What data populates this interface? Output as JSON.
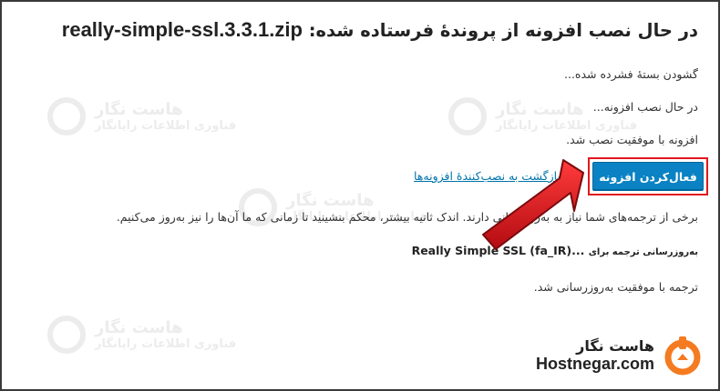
{
  "title": {
    "prefix": "در حال نصب افزونه از پروندهٔ فرستاده شده:",
    "filename": "really-simple-ssl.3.3.1.zip"
  },
  "messages": {
    "unpacking": "گشودن بستهٔ فشرده شده...",
    "installing": "در حال نصب افزونه...",
    "success": "افزونه با موفقیت نصب شد."
  },
  "actions": {
    "activate_label": "فعال‌کردن افزونه",
    "back_link": "بازگشت به نصب‌کنندهٔ افزونه‌ها"
  },
  "translations": {
    "notice": "برخی از ترجمه‌های شما نیاز به به‌روزرسانی دارند. اندک ثانیه بیشتر، محکم بنشینید تا زمانی که ما آن‌ها را نیز به‌روز می‌کنیم.",
    "updating_prefix": "به‌روزرسانی ترجمه برای",
    "updating_target": "Really Simple SSL (fa_IR)...",
    "done": "ترجمه با موفقیت به‌روزرسانی شد."
  },
  "watermark": {
    "name": "هاست نگار",
    "tagline": "فناوری اطلاعات رایانگار"
  },
  "brand": {
    "name_fa": "هاست نگار",
    "name_en": "Hostnegar.com",
    "color": "#f47b20"
  },
  "colors": {
    "button": "#0a82c4",
    "highlight": "#e0171d",
    "link": "#0073aa",
    "arrow": "#d4141a"
  }
}
